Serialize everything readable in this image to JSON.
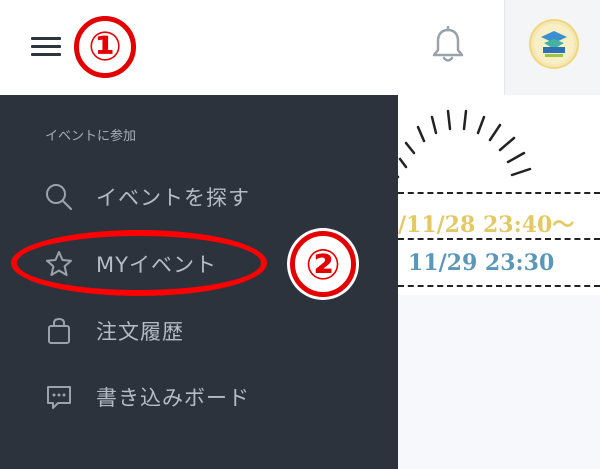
{
  "header": {
    "menu_icon": "hamburger-menu-icon",
    "notification_icon": "bell-icon",
    "avatar_icon": "user-avatar-icon"
  },
  "annotations": {
    "step1": "①",
    "step2": "②",
    "color": "#e30000"
  },
  "drawer": {
    "heading": "イベントに参加",
    "items": [
      {
        "label": "イベントを探す",
        "icon": "search-icon"
      },
      {
        "label": "MYイベント",
        "icon": "star-icon"
      },
      {
        "label": "注文履歴",
        "icon": "shopping-bag-icon"
      },
      {
        "label": "書き込みボード",
        "icon": "chat-bubble-icon"
      }
    ]
  },
  "background": {
    "date1": "/11/28  23:40～",
    "date2": "11/29  23:30"
  },
  "colors": {
    "drawer_bg": "#2c333d",
    "drawer_text": "#b5bcc6",
    "accent_red": "#ff0000"
  }
}
